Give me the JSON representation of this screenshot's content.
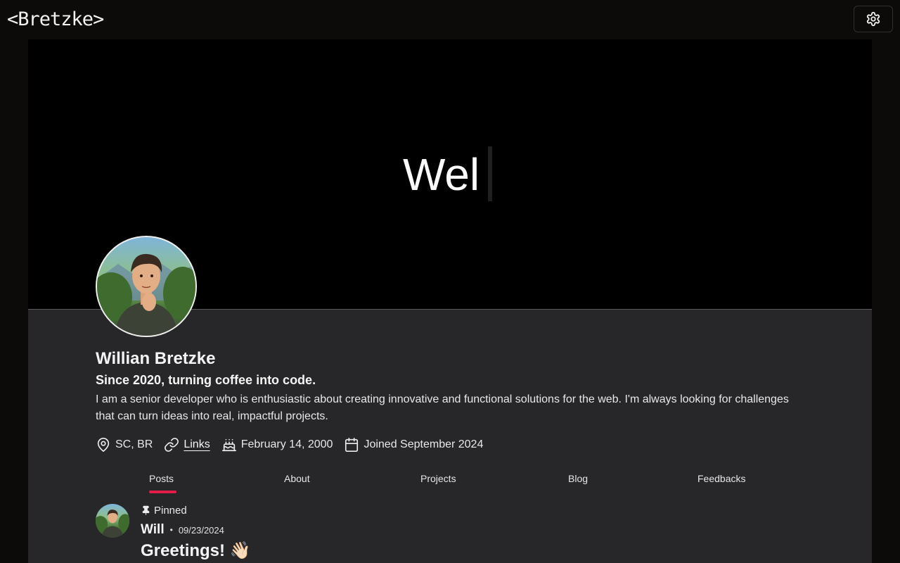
{
  "header": {
    "logo": "<Bretzke>",
    "settings_icon": "gear-icon"
  },
  "banner": {
    "typed_text": "Wel"
  },
  "profile": {
    "name": "Willian Bretzke",
    "tagline": "Since 2020, turning coffee into code.",
    "bio": "I am a senior developer who is enthusiastic about creating innovative and functional solutions for the web. I'm always looking for challenges that can turn ideas into real, impactful projects.",
    "location": "SC, BR",
    "links_label": "Links",
    "birthday": "February 14, 2000",
    "joined": "Joined September 2024"
  },
  "tabs": [
    {
      "label": "Posts",
      "active": true
    },
    {
      "label": "About",
      "active": false
    },
    {
      "label": "Projects",
      "active": false
    },
    {
      "label": "Blog",
      "active": false
    },
    {
      "label": "Feedbacks",
      "active": false
    }
  ],
  "post": {
    "pinned_label": "Pinned",
    "author": "Will",
    "separator": "•",
    "date": "09/23/2024",
    "title": "Greetings! 👋🏻"
  },
  "colors": {
    "accent": "#e11d48",
    "panel": "#27272a",
    "page": "#0c0b09"
  }
}
